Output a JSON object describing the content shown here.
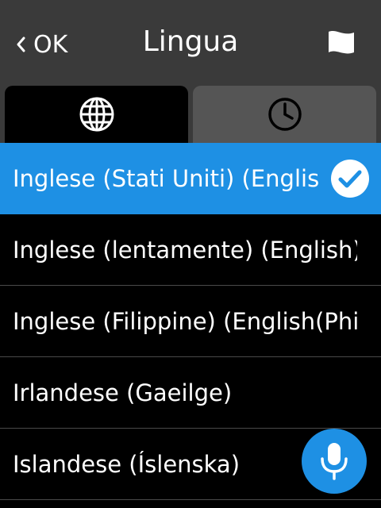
{
  "header": {
    "back_label": "OK",
    "title": "Lingua"
  },
  "tabs": [
    {
      "name": "languages",
      "icon": "globe-icon",
      "active": true
    },
    {
      "name": "recent",
      "icon": "clock-icon",
      "active": false
    }
  ],
  "languages": [
    {
      "label": "Inglese (Stati Uniti) (English)",
      "selected": true
    },
    {
      "label": "Inglese (lentamente) (English)",
      "selected": false
    },
    {
      "label": "Inglese (Filippine) (English(Philippines))",
      "selected": false
    },
    {
      "label": "Irlandese (Gaeilge)",
      "selected": false
    },
    {
      "label": "Islandese (Íslenska)",
      "selected": false
    }
  ],
  "colors": {
    "accent": "#1e90e4",
    "header_bg": "#3a3a3a",
    "inactive_tab": "#555555",
    "background": "#000000"
  }
}
